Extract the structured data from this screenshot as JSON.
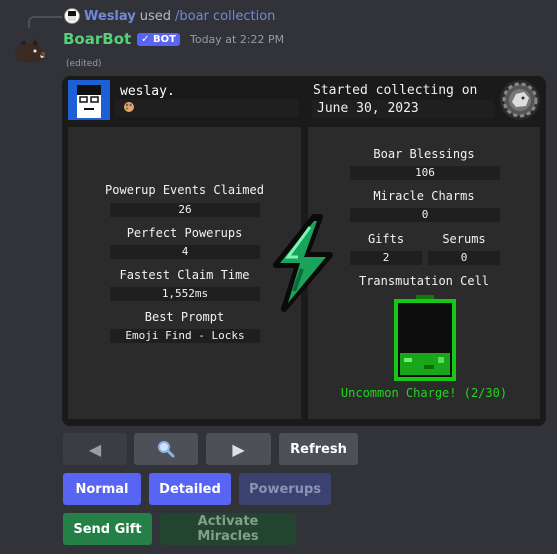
{
  "reply": {
    "username": "Weslay",
    "used": "used",
    "command": "/boar collection"
  },
  "message": {
    "author": "BoarBot",
    "bot_tag": "✓ BOT",
    "timestamp": "Today at 2:22 PM",
    "edited": "(edited)"
  },
  "profile": {
    "username": "weslay.",
    "started_label": "Started collecting on",
    "started_date": "June 30, 2023"
  },
  "powerup_stats": {
    "events_label": "Powerup Events Claimed",
    "events_value": "26",
    "perfect_label": "Perfect Powerups",
    "perfect_value": "4",
    "fastest_label": "Fastest Claim Time",
    "fastest_value": "1,552ms",
    "best_prompt_label": "Best Prompt",
    "best_prompt_value": "Emoji Find - Locks"
  },
  "items": {
    "blessings_label": "Boar Blessings",
    "blessings_value": "106",
    "charms_label": "Miracle Charms",
    "charms_value": "0",
    "gifts_label": "Gifts",
    "gifts_value": "2",
    "serums_label": "Serums",
    "serums_value": "0",
    "cell_label": "Transmutation Cell",
    "cell_charge_text": "Uncommon Charge! (2/30)",
    "cell_charge_fraction": 0.067
  },
  "colors": {
    "bot_name": "#57d17a",
    "charge_green": "#1fd61f",
    "blurple": "#5865f2",
    "success": "#248046"
  },
  "buttons": {
    "prev_icon": "◀",
    "search_icon": "🔍",
    "next_icon": "▶",
    "refresh": "Refresh",
    "normal": "Normal",
    "detailed": "Detailed",
    "powerups": "Powerups",
    "send_gift": "Send Gift",
    "activate_miracles": "Activate Miracles"
  }
}
